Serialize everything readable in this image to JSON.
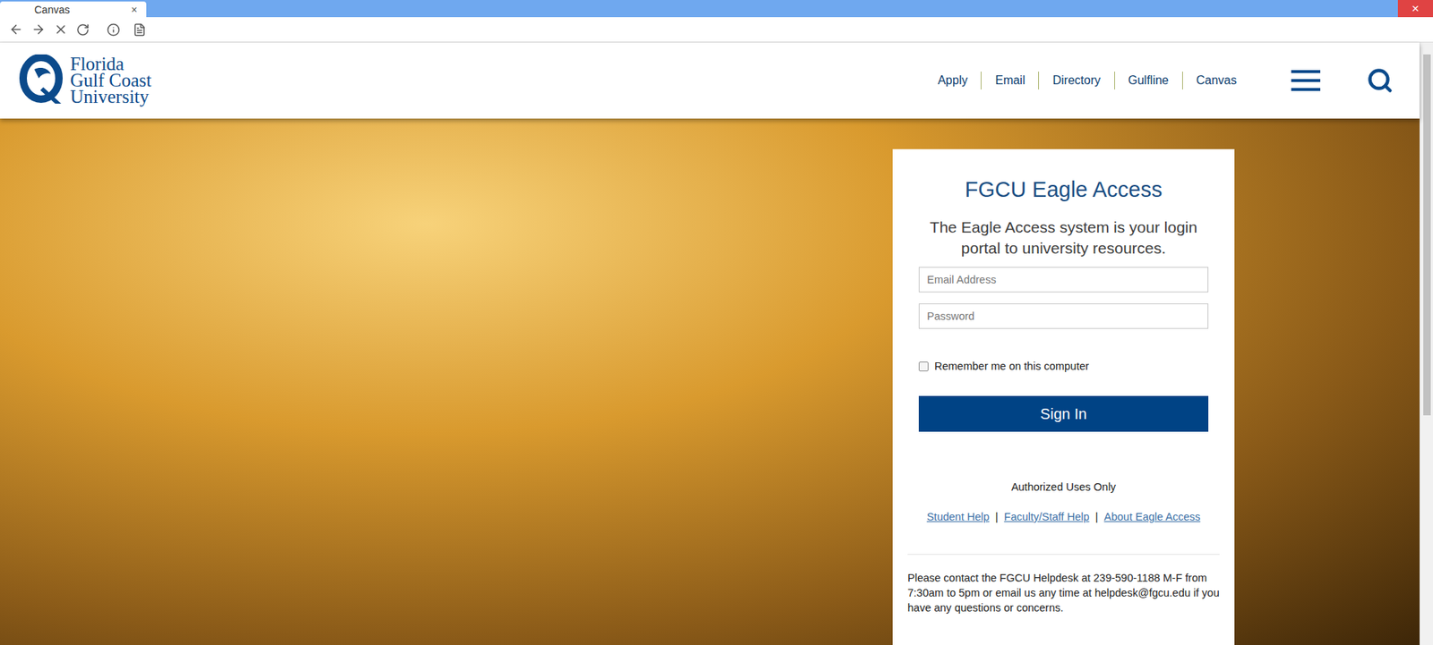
{
  "browser": {
    "tab": {
      "title": "Canvas",
      "close": "×",
      "selected": true
    },
    "close_button": "×"
  },
  "header": {
    "logo": [
      "Florida",
      "Gulf Coast",
      "University"
    ],
    "nav": [
      "Apply",
      "Email",
      "Directory",
      "Gulfline",
      "Canvas"
    ]
  },
  "login": {
    "title": "FGCU Eagle Access",
    "subtitle": "The Eagle Access system is your login portal to university resources.",
    "fields": [
      {
        "placeholder": "Email Address",
        "kind": "email"
      },
      {
        "placeholder": "Password",
        "kind": "password"
      }
    ],
    "remember": {
      "label": "Remember me on this computer",
      "checked": false
    },
    "submit": "Sign In",
    "notice": "Authorized Uses Only",
    "links": [
      "Student Help",
      "Faculty/Staff Help",
      "About Eagle Access"
    ],
    "link_separator": "|",
    "help": "Please contact the FGCU Helpdesk at 239-590-1188 M-F from 7:30am to 5pm or email us any time at helpdesk@fgcu.edu if you have any questions or concerns."
  }
}
